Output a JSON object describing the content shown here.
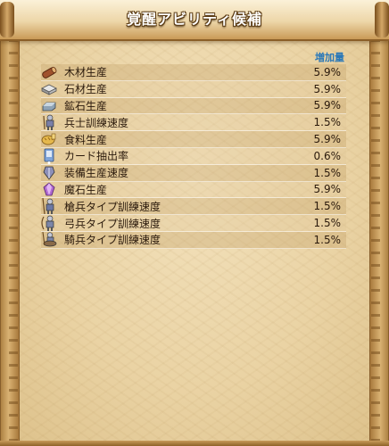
{
  "title": "覚醒アビリティ候補",
  "column_header": "増加量",
  "rows": [
    {
      "name": "木材生産",
      "value": "5.9%",
      "icon": "wood-log-icon"
    },
    {
      "name": "石材生産",
      "value": "5.9%",
      "icon": "stone-block-icon"
    },
    {
      "name": "鉱石生産",
      "value": "5.9%",
      "icon": "ore-ingot-icon"
    },
    {
      "name": "兵士訓練速度",
      "value": "1.5%",
      "icon": "soldier-icon"
    },
    {
      "name": "食料生産",
      "value": "5.9%",
      "icon": "food-bread-icon"
    },
    {
      "name": "カード抽出率",
      "value": "0.6%",
      "icon": "card-draw-icon"
    },
    {
      "name": "装備生産速度",
      "value": "1.5%",
      "icon": "equipment-icon"
    },
    {
      "name": "魔石生産",
      "value": "5.9%",
      "icon": "magic-stone-icon"
    },
    {
      "name": "槍兵タイプ訓練速度",
      "value": "1.5%",
      "icon": "spearman-icon"
    },
    {
      "name": "弓兵タイプ訓練速度",
      "value": "1.5%",
      "icon": "archer-icon"
    },
    {
      "name": "騎兵タイプ訓練速度",
      "value": "1.5%",
      "icon": "cavalry-icon"
    }
  ]
}
